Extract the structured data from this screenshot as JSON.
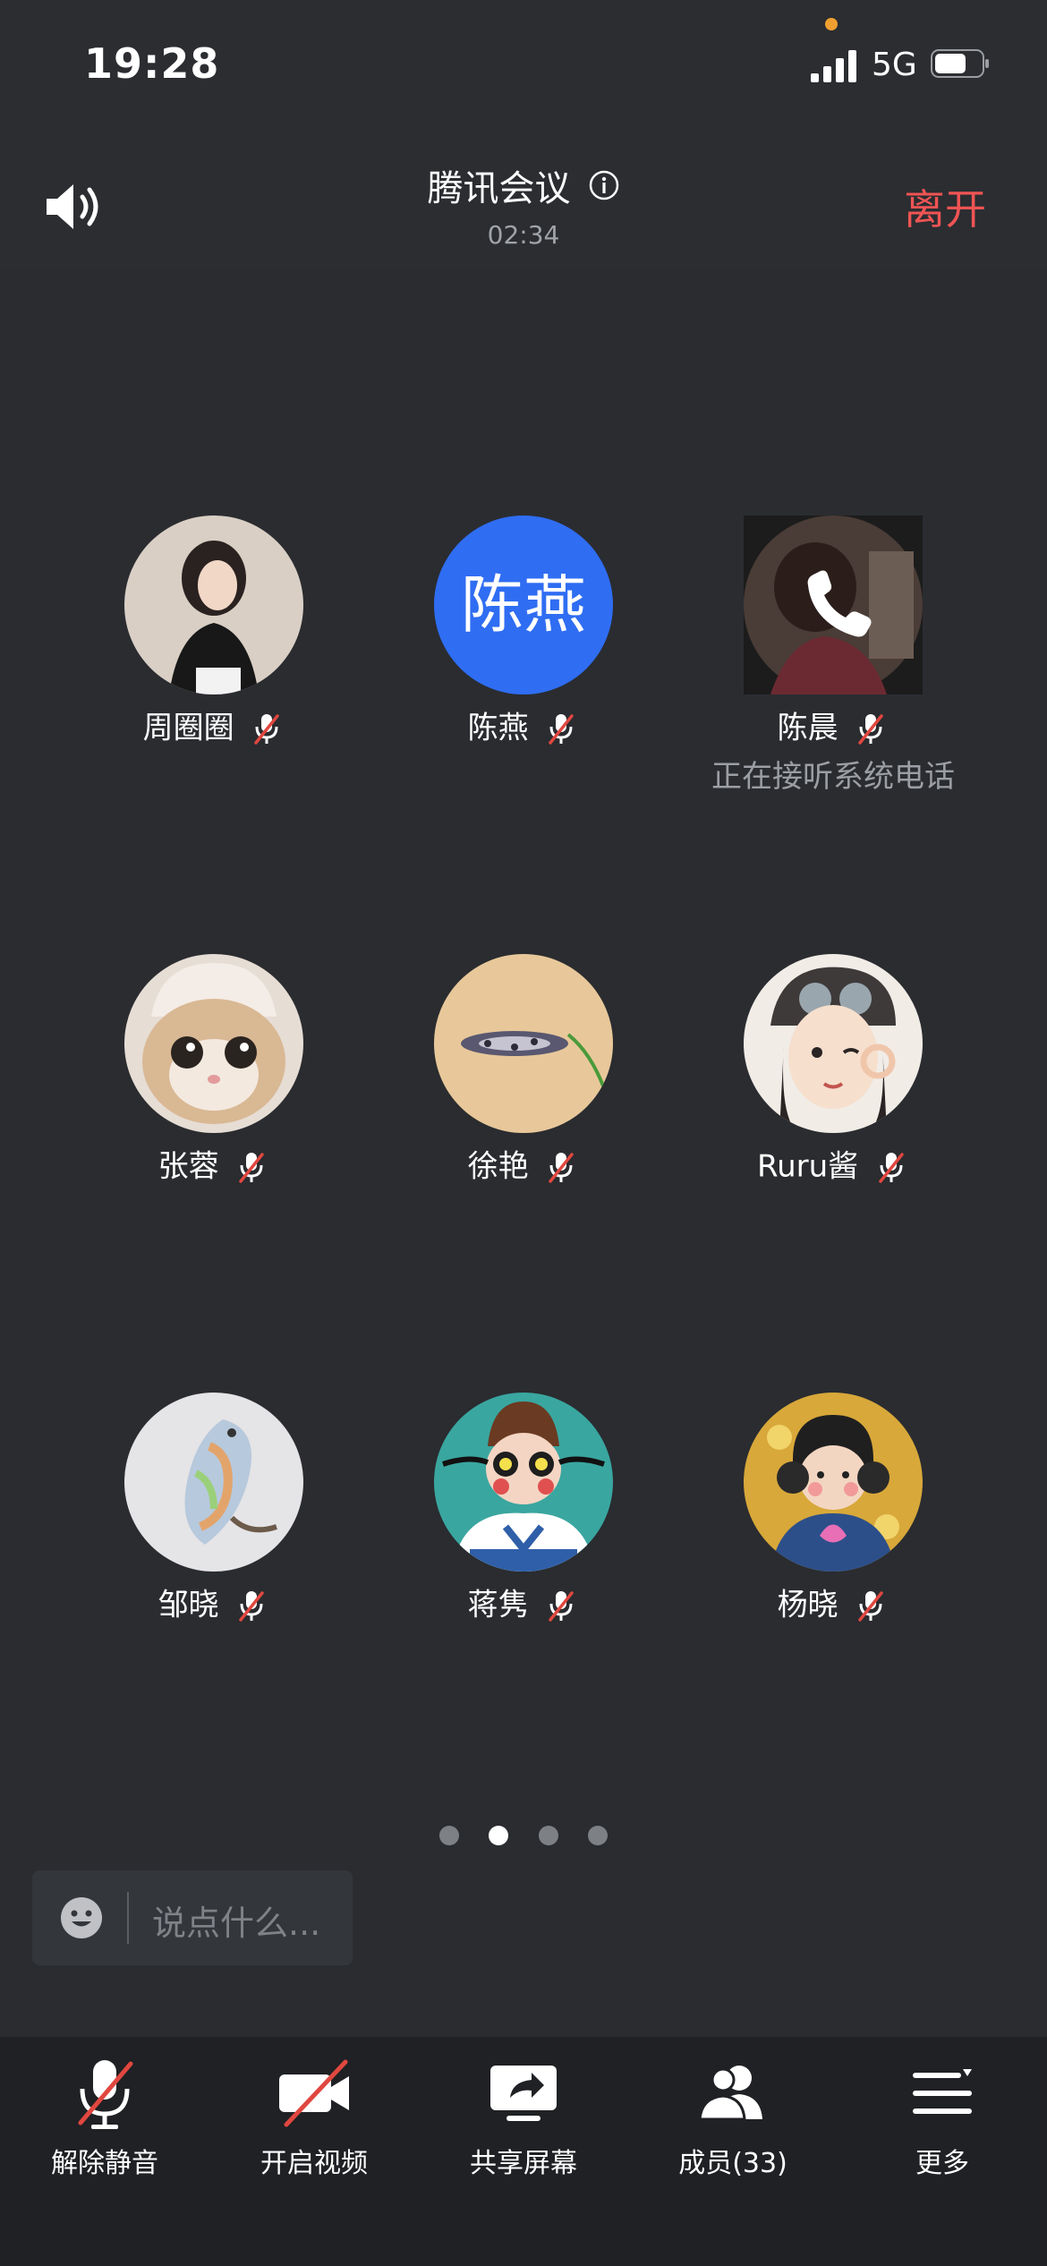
{
  "status_bar": {
    "time": "19:28",
    "network": "5G"
  },
  "header": {
    "title": "腾讯会议",
    "timer": "02:34",
    "leave_label": "离开"
  },
  "participants": [
    {
      "name": "周圈圈",
      "muted": true
    },
    {
      "name": "陈燕",
      "avatar_text": "陈燕",
      "muted": true
    },
    {
      "name": "陈晨",
      "status": "正在接听系统电话",
      "muted": true
    },
    {
      "name": "张蓉",
      "muted": true
    },
    {
      "name": "徐艳",
      "muted": true
    },
    {
      "name": "Ruru酱",
      "muted": true
    },
    {
      "name": "邹晓",
      "muted": true
    },
    {
      "name": "蒋隽",
      "muted": true
    },
    {
      "name": "杨晓",
      "muted": true
    }
  ],
  "pager": {
    "pages": 4,
    "active_index": 1
  },
  "chat": {
    "placeholder": "说点什么..."
  },
  "toolbar": {
    "unmute": "解除静音",
    "video": "开启视频",
    "share": "共享屏幕",
    "members": "成员(33)",
    "more": "更多"
  },
  "colors": {
    "leave": "#f05454",
    "avatar_blue": "#2f6df2",
    "mute_slash": "#e0473f"
  }
}
